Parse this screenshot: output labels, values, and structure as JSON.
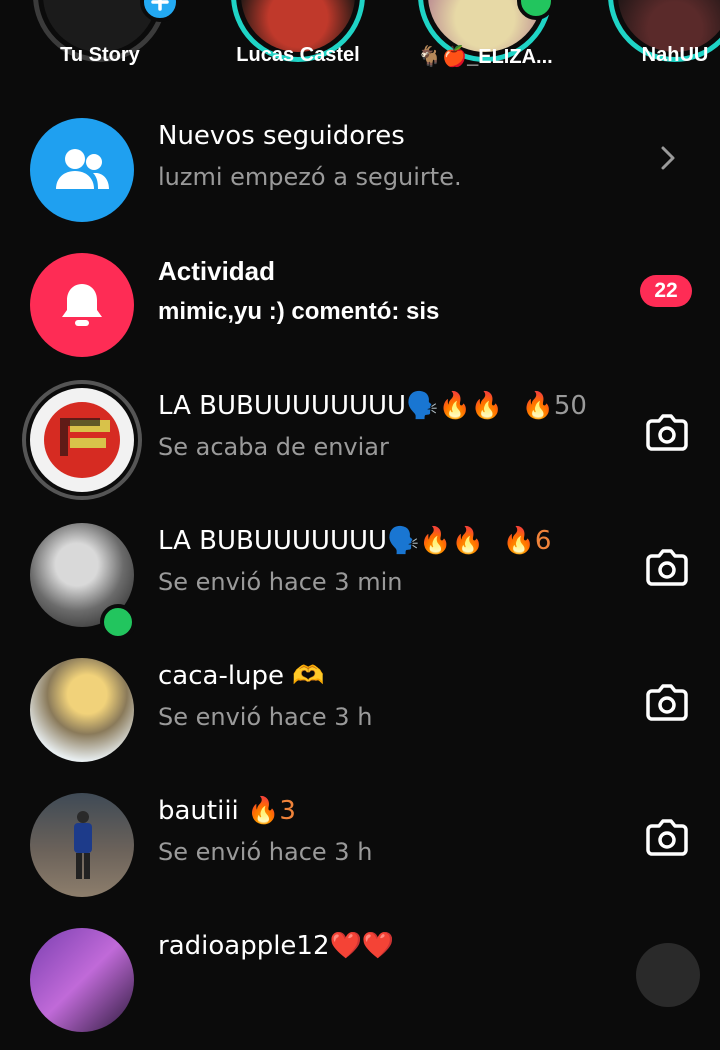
{
  "stories": [
    {
      "name": "Tu Story"
    },
    {
      "name": "Lucas Castel"
    },
    {
      "name": "🐐🍎_ELIZA..."
    },
    {
      "name": "NahUU"
    }
  ],
  "notifications": [
    {
      "title": "Nuevos seguidores",
      "subtitle": "luzmi empezó a seguirte."
    },
    {
      "title": "Actividad",
      "subtitle": "mimic,yu :) comentó: sis",
      "badge": "22"
    }
  ],
  "chats": [
    {
      "name": "LA BUBUUUUUUUU",
      "emojis": "🗣️🔥🔥",
      "streak_icon": "🔥",
      "streak": "50",
      "status": "Se acaba de enviar"
    },
    {
      "name": "LA BUBUUUUUUU",
      "emojis": "🗣️🔥🔥",
      "streak_icon": "🔥",
      "streak": "6",
      "status": "Se envió hace 3 min"
    },
    {
      "name": "caca-lupe",
      "emojis": "🫶",
      "status": "Se envió hace 3 h"
    },
    {
      "name": "bautiii",
      "streak_icon": "🔥",
      "streak": "3",
      "status": "Se envió hace 3 h"
    },
    {
      "name": "radioapple12",
      "emojis": "❤️❤️"
    }
  ],
  "colors": {
    "background": "#0b0b0b",
    "followers_icon_bg": "#1fa0f0",
    "activity_icon_bg": "#fe2c55",
    "badge": "#fe2c55",
    "story_ring": "#1fd4c6",
    "online": "#22c55e",
    "streak": "#f0833a"
  },
  "icons": {
    "add_story": "plus-icon",
    "followers": "users-icon",
    "activity": "bell-icon",
    "open": "chevron-right-icon",
    "camera": "camera-icon"
  }
}
